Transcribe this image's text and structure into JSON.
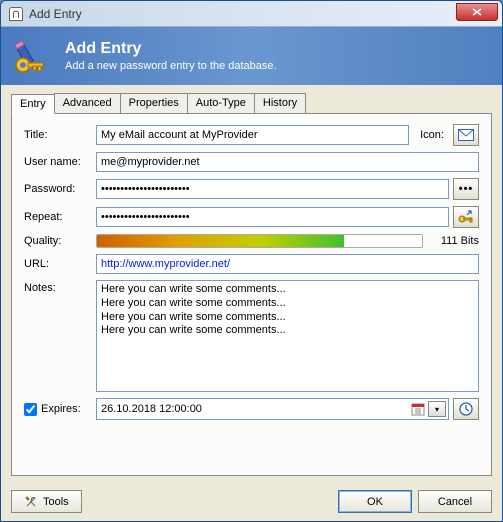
{
  "window": {
    "title": "Add Entry"
  },
  "header": {
    "title": "Add Entry",
    "subtitle": "Add a new password entry to the database."
  },
  "tabs": {
    "items": [
      "Entry",
      "Advanced",
      "Properties",
      "Auto-Type",
      "History"
    ],
    "active": 0
  },
  "form": {
    "title_label": "Title:",
    "title_value": "My eMail account at MyProvider",
    "icon_label": "Icon:",
    "username_label": "User name:",
    "username_value": "me@myprovider.net",
    "password_label": "Password:",
    "password_value": "•••••••••••••••••••••••",
    "repeat_label": "Repeat:",
    "repeat_value": "•••••••••••••••••••••••",
    "quality_label": "Quality:",
    "quality_bits": "111 Bits",
    "quality_percent": 76,
    "url_label": "URL:",
    "url_value": "http://www.myprovider.net/",
    "notes_label": "Notes:",
    "notes_value": "Here you can write some comments...\nHere you can write some comments...\nHere you can write some comments...\nHere you can write some comments...",
    "expires_label": "Expires:",
    "expires_value": "26.10.2018 12:00:00",
    "expires_checked": true
  },
  "buttons": {
    "tools": "Tools",
    "ok": "OK",
    "cancel": "Cancel"
  }
}
